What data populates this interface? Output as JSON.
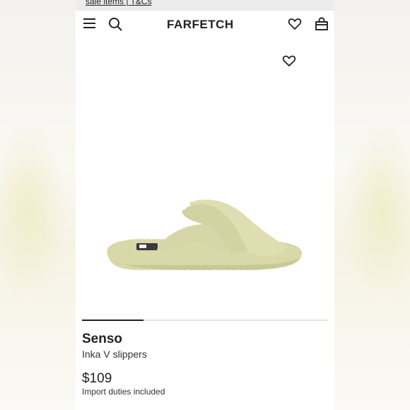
{
  "promo": {
    "text": "sale items | T&Cs"
  },
  "header": {
    "logo": "FARFETCH",
    "menu_icon": "hamburger-menu-icon",
    "search_icon": "search-icon",
    "wishlist_icon": "heart-icon",
    "bag_icon": "shopping-bag-icon"
  },
  "product": {
    "image_alt": "slipper-image",
    "favourite_icon": "heart-icon",
    "brand": "Senso",
    "name": "Inka V slippers",
    "price": "$109",
    "duties_note": "Import duties included",
    "carousel": {
      "slides": 4,
      "active_index": 1
    }
  },
  "colors": {
    "text": "#222222",
    "promo_bg": "#ececec",
    "slipper": "#dcdcb0"
  }
}
